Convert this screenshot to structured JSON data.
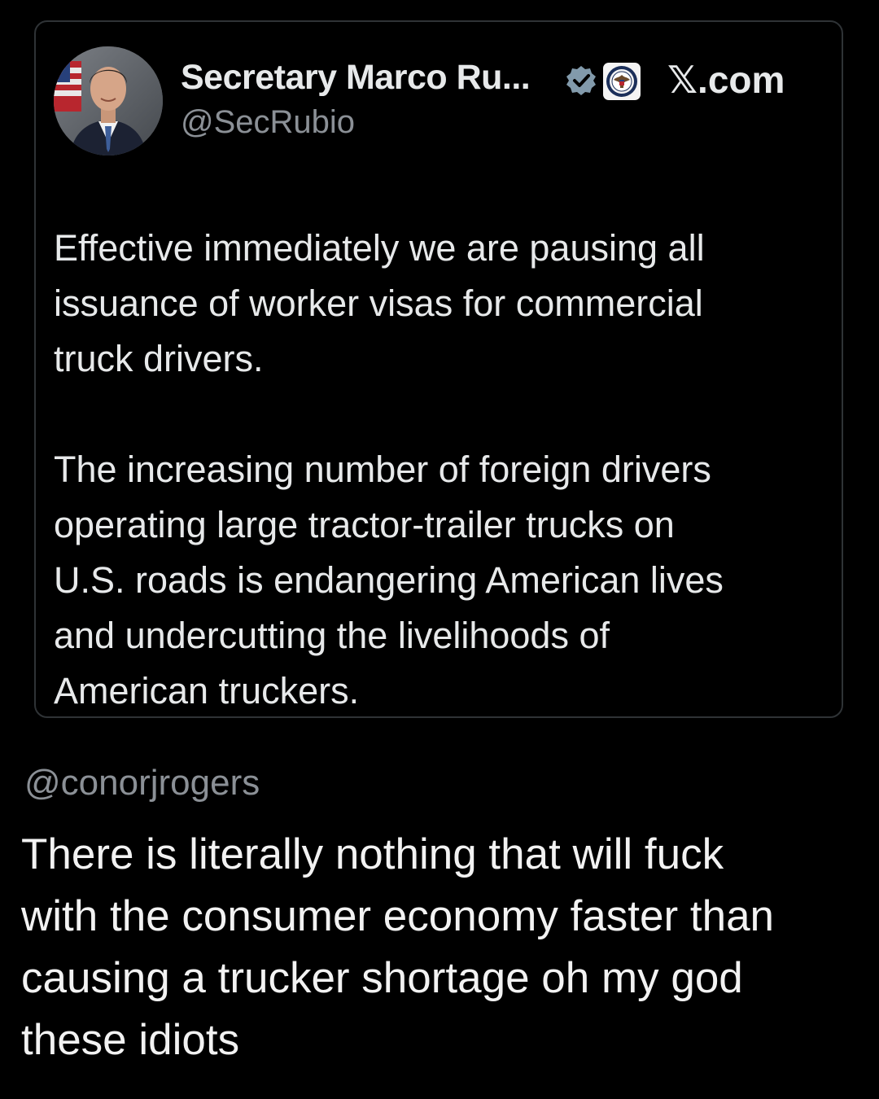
{
  "quoted_post": {
    "author_name": "Secretary Marco Ru...",
    "handle": "@SecRubio",
    "site": "𝕏.com",
    "avatar_icon": "profile-photo",
    "verified_icon": "verified-badge-icon",
    "affiliation_icon": "state-department-seal-icon",
    "badge_color": "#829aab",
    "lines": [
      "Effective immediately we are pausing all",
      "issuance of worker visas for commercial",
      "truck drivers.",
      "",
      "The increasing number of foreign drivers",
      "operating large tractor-trailer trucks on",
      "U.S. roads is endangering American lives",
      "and undercutting the livelihoods of",
      "American truckers."
    ]
  },
  "reply": {
    "handle": "@conorjrogers",
    "lines": [
      "There is literally nothing that will fuck",
      "with the consumer economy faster than",
      "causing a trucker shortage oh my god",
      "these idiots"
    ]
  }
}
